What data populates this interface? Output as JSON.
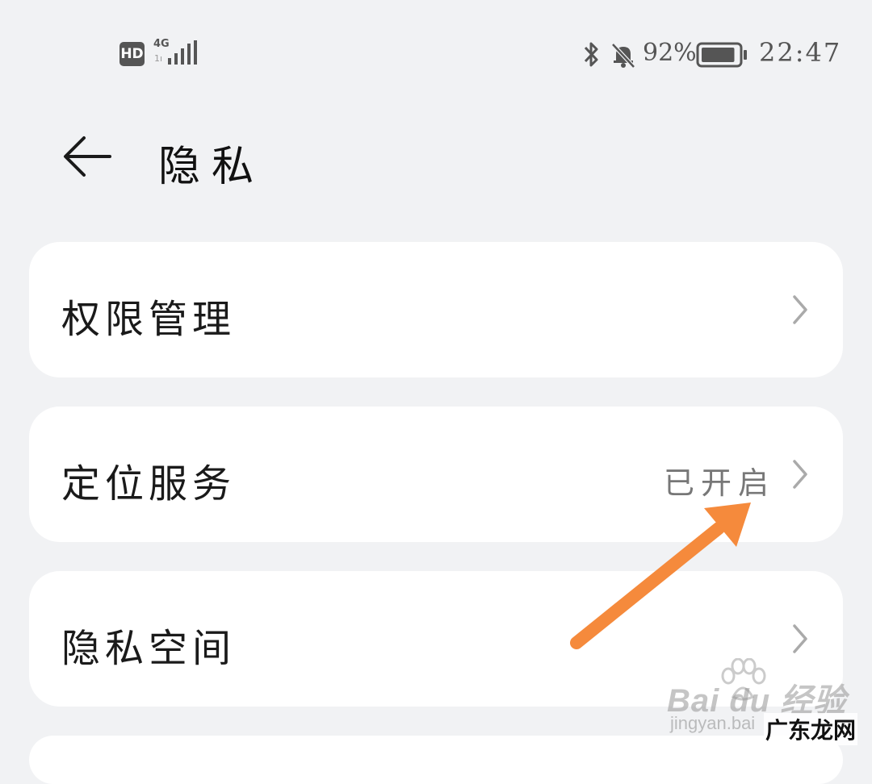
{
  "status_bar": {
    "hd": "HD",
    "network": "4G",
    "network_sub": "1ı",
    "battery_percent": "92%",
    "battery_level": 0.92,
    "time": "22:47",
    "icons": [
      "signal-icon",
      "bluetooth-icon",
      "bell-off-icon",
      "battery-icon"
    ]
  },
  "header": {
    "title": "隐私",
    "back_icon": "arrow-left-icon"
  },
  "settings": [
    {
      "label": "权限管理",
      "value": "",
      "icon": "chevron-right-icon"
    },
    {
      "label": "定位服务",
      "value": "已开启",
      "icon": "chevron-right-icon"
    },
    {
      "label": "隐私空间",
      "value": "",
      "icon": "chevron-right-icon"
    }
  ],
  "annotation": {
    "arrow_color": "#f58a3c"
  },
  "watermark": {
    "logo": "Bai du 经验",
    "url": "jingyan.bai",
    "brand": "广东龙网"
  }
}
